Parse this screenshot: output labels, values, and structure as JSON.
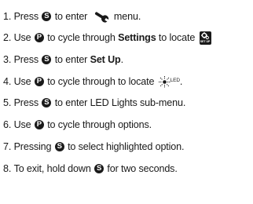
{
  "steps": [
    {
      "number": "1.",
      "text_a": "Press ",
      "button": "S",
      "text_b": " to enter ",
      "icon": "wrench-icon",
      "text_c": " menu."
    },
    {
      "number": "2.",
      "text_a": "Use ",
      "button": "P",
      "text_b": " to cycle through ",
      "bold": "Settings",
      "text_c": " to locate ",
      "icon": "setup-icon",
      "icon_caption": "SET UP"
    },
    {
      "number": "3.",
      "text_a": "Press ",
      "button": "S",
      "text_b": " to enter ",
      "bold": "Set Up",
      "text_c": "."
    },
    {
      "number": "4.",
      "text_a": "Use ",
      "button": "P",
      "text_b": " to cycle through to locate ",
      "icon": "led-icon",
      "icon_caption": "LED",
      "text_c": "."
    },
    {
      "number": "5.",
      "text_a": "Press ",
      "button": "S",
      "text_b": " to enter LED Lights sub-menu."
    },
    {
      "number": "6.",
      "text_a": "Use ",
      "button": "P",
      "text_b": " to cycle through options."
    },
    {
      "number": "7.",
      "text_a": "Pressing ",
      "button": "S",
      "text_b": " to select highlighted option."
    },
    {
      "number": "8.",
      "text_a": "To exit, hold down ",
      "button": "S",
      "text_b": " for two seconds."
    }
  ],
  "colors": {
    "text": "#1a1a1a",
    "background": "#ffffff",
    "button_fill": "#1a1a1a",
    "button_glyph": "#ffffff"
  }
}
